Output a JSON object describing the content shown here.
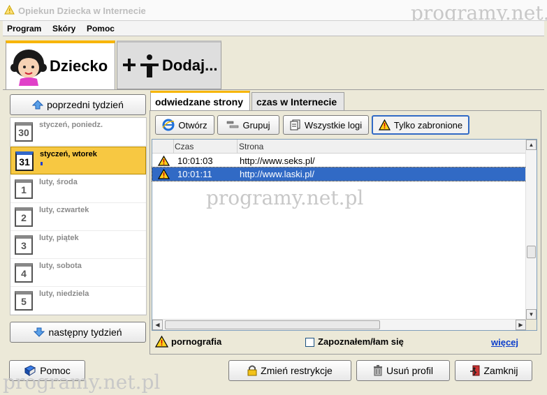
{
  "window": {
    "title": "Opiekun Dziecka w Internecie",
    "watermark": "programy.net.pl"
  },
  "menu": {
    "items": [
      "Program",
      "Skóry",
      "Pomoc"
    ]
  },
  "big_tabs": [
    {
      "label": "Dziecko"
    },
    {
      "label": "Dodaj..."
    }
  ],
  "left": {
    "prev_week": "poprzedni tydzień",
    "next_week": "następny tydzień",
    "days": [
      {
        "num": "30",
        "label": "styczeń, poniedz."
      },
      {
        "num": "31",
        "label": "styczeń, wtorek"
      },
      {
        "num": "1",
        "label": "luty, środa"
      },
      {
        "num": "2",
        "label": "luty, czwartek"
      },
      {
        "num": "3",
        "label": "luty, piątek"
      },
      {
        "num": "4",
        "label": "luty, sobota"
      },
      {
        "num": "5",
        "label": "luty, niedziela"
      }
    ]
  },
  "tabs": {
    "visited": "odwiedzane strony",
    "time": "czas w Internecie"
  },
  "toolbar": {
    "open": "Otwórz",
    "group": "Grupuj",
    "all_logs": "Wszystkie logi",
    "only_forbidden": "Tylko zabronione"
  },
  "table": {
    "headers": {
      "time": "Czas",
      "page": "Strona"
    },
    "rows": [
      {
        "time": "10:01:03",
        "url": "http://www.seks.pl/"
      },
      {
        "time": "10:01:11",
        "url": "http://www.laski.pl/"
      }
    ]
  },
  "footer_info": {
    "category": "pornografia",
    "acknowledged": "Zapoznałem/łam się",
    "more": "więcej"
  },
  "bottom": {
    "help": "Pomoc",
    "change_restrictions": "Zmień restrykcje",
    "delete_profile": "Usuń profil",
    "close": "Zamknij"
  },
  "colors": {
    "accent": "#f7b500",
    "selection": "#316ac5",
    "link": "#0b3dcc"
  }
}
